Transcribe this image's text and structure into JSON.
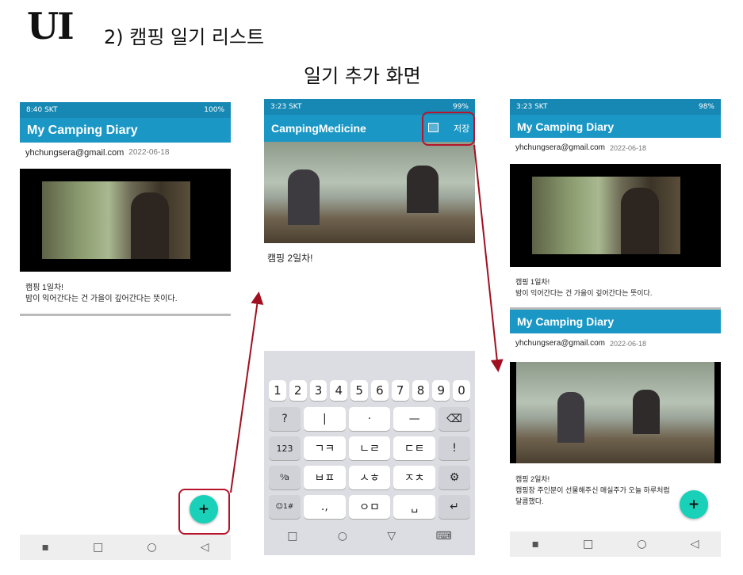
{
  "slide": {
    "title": "UI",
    "subtitle": "2) 캠핑 일기 리스트",
    "caption": "일기 추가 화면"
  },
  "left": {
    "status_time": "8:40 SKT",
    "status_right": "100%",
    "app_title": "My Camping Diary",
    "email": "yhchungsera@gmail.com",
    "date": "2022-06-18",
    "text1": "캠핑 1일차!",
    "text2": "밤이 익어간다는 건 가을이 깊어간다는 뜻이다.",
    "fab": "+",
    "nav": [
      "▪",
      "□",
      "○",
      "◁"
    ]
  },
  "middle": {
    "status_time": "3:23 SKT",
    "status_right": "99%",
    "app_title": "CampingMedicine",
    "save_label": "저장",
    "text": "캠핑 2일차!",
    "keys_numbers": [
      "1",
      "2",
      "3",
      "4",
      "5",
      "6",
      "7",
      "8",
      "9",
      "0"
    ],
    "row2": [
      "?",
      "|",
      "·",
      "—",
      "⌫"
    ],
    "row3": [
      "123",
      "ㄱㅋ",
      "ㄴㄹ",
      "ㄷㅌ",
      "!"
    ],
    "row4": [
      "⁰⁄a",
      "ㅂㅍ",
      "ㅅㅎ",
      "ㅈㅊ",
      "⚙"
    ],
    "row5": [
      "☺1#",
      ".,",
      "ㅇㅁ",
      "␣",
      "↵"
    ],
    "nav": [
      "□",
      "○",
      "▽",
      "⌨"
    ]
  },
  "right": {
    "status_time": "3:23 SKT",
    "status_right": "98%",
    "app_title": "My Camping Diary",
    "card1": {
      "email": "yhchungsera@gmail.com",
      "date": "2022-06-18",
      "text1": "캠핑 1일차!",
      "text2": "밤이 익어간다는 건 가을이 깊어간다는 뜻이다."
    },
    "card2": {
      "title": "My Camping Diary",
      "email": "yhchungsera@gmail.com",
      "date": "2022-06-18",
      "text1": "캠핑 2일차!",
      "text2": "캠핑장 주인분이 선물해주신 매실주가 오늘 하루처럼",
      "text3": "달콤했다."
    },
    "fab": "+",
    "nav": [
      "▪",
      "□",
      "○",
      "◁"
    ]
  },
  "colors": {
    "appbar": "#1a97c5",
    "fab": "#19d1b8",
    "highlight": "#b7142b"
  }
}
